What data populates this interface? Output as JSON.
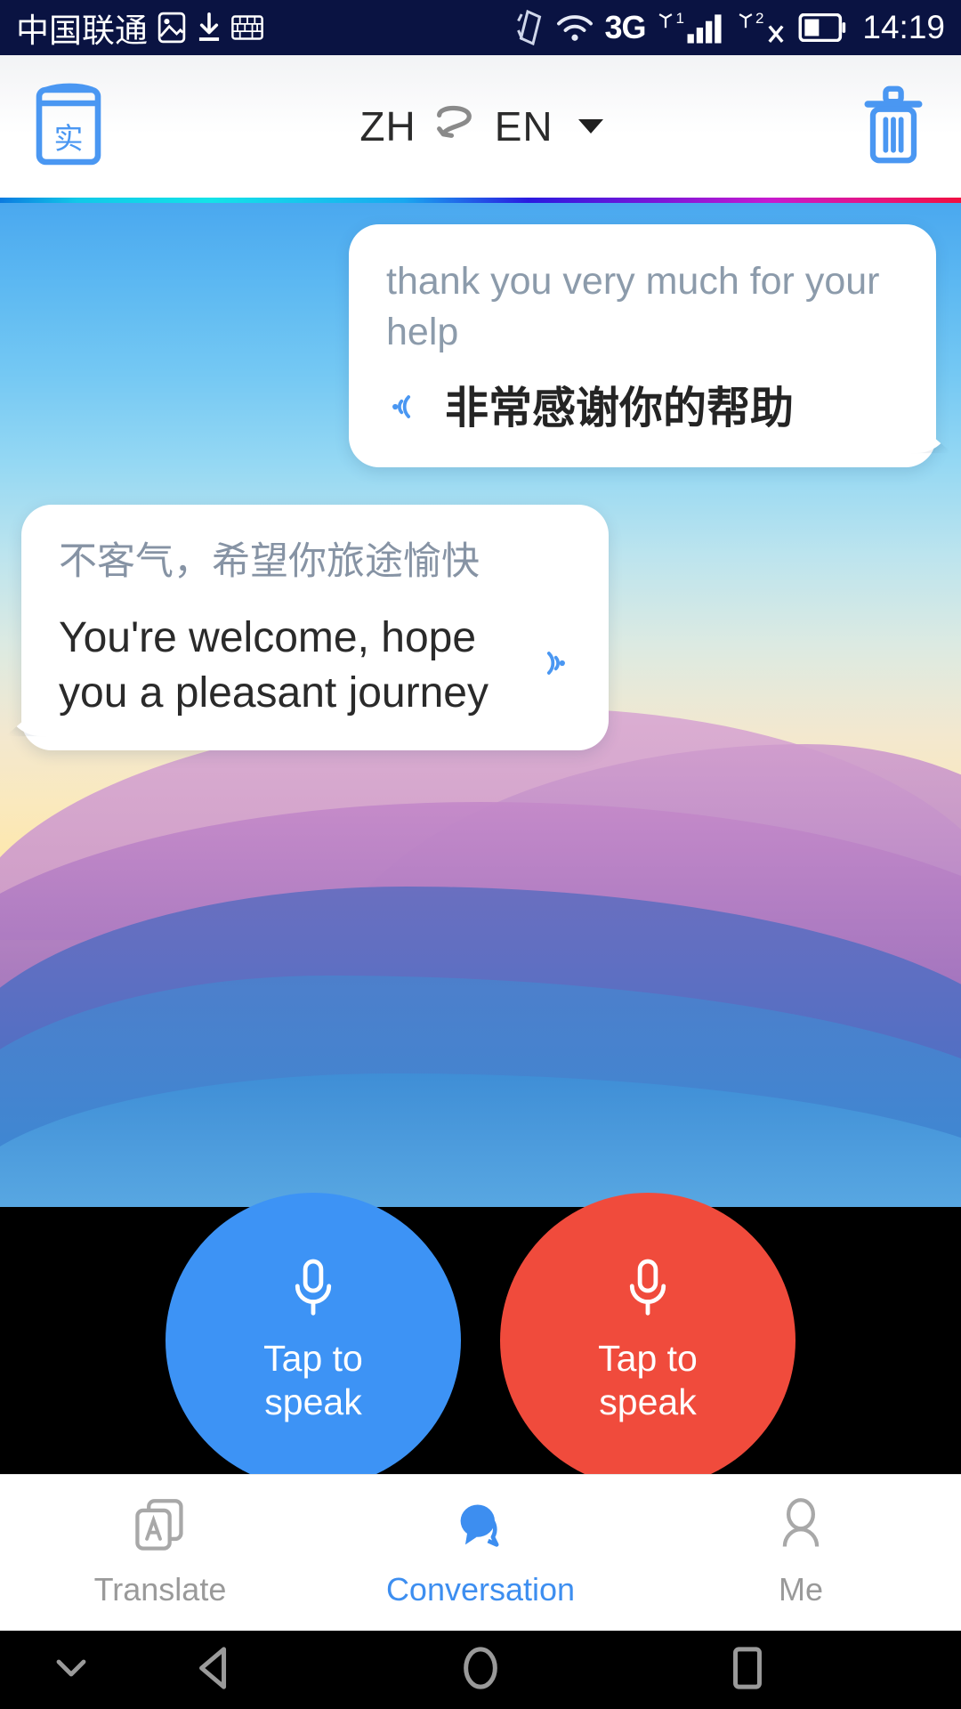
{
  "status_bar": {
    "carrier": "中国联通",
    "time": "14:19",
    "network_type": "3G",
    "sim1_label": "1",
    "sim2_label": "2",
    "icons": [
      "image-icon",
      "download-icon",
      "keyboard-icon",
      "shake-icon",
      "wifi-icon",
      "signal-icon",
      "battery-icon"
    ],
    "background": "#0a1342"
  },
  "app_bar": {
    "dictionary_icon_char": "实",
    "source_lang": "ZH",
    "swap_glyph": "⇄",
    "target_lang": "EN",
    "delete_icon": "trash-icon",
    "accent": "#3d8ef0"
  },
  "conversation": {
    "messages": [
      {
        "side": "right",
        "source_text": "thank you very much for your help",
        "translated_text": "非常感谢你的帮助",
        "speaker_icon": "speaker-left-icon"
      },
      {
        "side": "left",
        "source_text": "不客气，希望你旅途愉快",
        "translated_text": "You're welcome, hope you a pleasant journey",
        "speaker_icon": "speaker-right-icon"
      }
    ]
  },
  "mic_buttons": [
    {
      "label": "Tap to\nspeak",
      "label_line1": "Tap to",
      "label_line2": "speak",
      "color": "#3d93f5",
      "icon": "microphone-icon"
    },
    {
      "label": "Tap to\nspeak",
      "label_line1": "Tap to",
      "label_line2": "speak",
      "color": "#f04b3c",
      "icon": "microphone-icon"
    }
  ],
  "tab_bar": {
    "active_color": "#3d8ef0",
    "inactive_color": "#9a9a9a",
    "tabs": [
      {
        "label": "Translate",
        "icon": "translate-cards-icon",
        "active": false
      },
      {
        "label": "Conversation",
        "icon": "chat-bubbles-icon",
        "active": true
      },
      {
        "label": "Me",
        "icon": "person-icon",
        "active": false
      }
    ]
  },
  "nav_bar": {
    "buttons": [
      "hide-keyboard-chevron-icon",
      "back-icon",
      "home-icon",
      "recents-icon"
    ]
  }
}
